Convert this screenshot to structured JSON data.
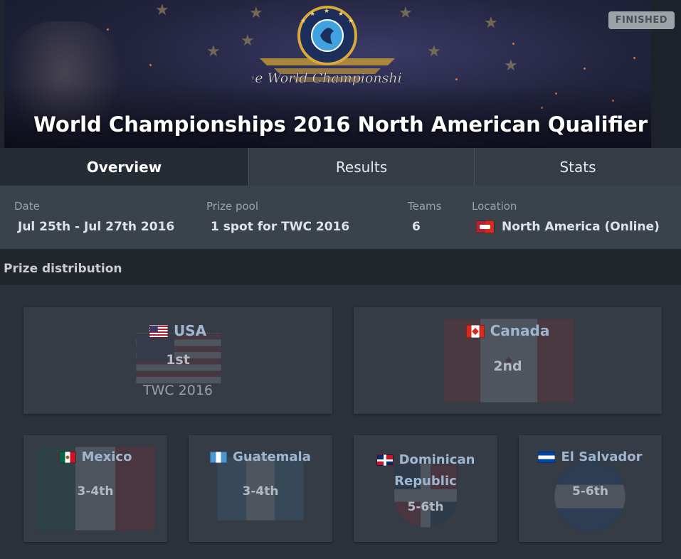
{
  "event": {
    "title": "World Championships 2016 North American Qualifier",
    "status": "FINISHED",
    "logo_text": "The World Championships"
  },
  "tabs": [
    {
      "label": "Overview",
      "active": true
    },
    {
      "label": "Results",
      "active": false
    },
    {
      "label": "Stats",
      "active": false
    }
  ],
  "info": {
    "date_label": "Date",
    "date_value": "Jul 25th - Jul 27th 2016",
    "prize_label": "Prize pool",
    "prize_value": "1 spot for TWC 2016",
    "teams_label": "Teams",
    "teams_value": "6",
    "location_label": "Location",
    "location_value": "North America (Online)",
    "location_flag_icon": "north-america-flag-icon"
  },
  "prize_distribution": {
    "title": "Prize distribution",
    "placements": [
      {
        "team": "USA",
        "place": "1st",
        "prize": "TWC 2016",
        "flag_icon": "usa-flag-icon"
      },
      {
        "team": "Canada",
        "place": "2nd",
        "prize": "",
        "flag_icon": "canada-flag-icon"
      },
      {
        "team": "Mexico",
        "place": "3-4th",
        "prize": "",
        "flag_icon": "mexico-flag-icon"
      },
      {
        "team": "Guatemala",
        "place": "3-4th",
        "prize": "",
        "flag_icon": "guatemala-flag-icon"
      },
      {
        "team_line1": "Dominican",
        "team_line2": "Republic",
        "place": "5-6th",
        "prize": "",
        "flag_icon": "dominican-republic-flag-icon"
      },
      {
        "team": "El Salvador",
        "place": "5-6th",
        "prize": "",
        "flag_icon": "el-salvador-flag-icon"
      }
    ]
  },
  "colors": {
    "team_name": "#9eb6cf",
    "background": "#2b323c",
    "card": "#353c46",
    "status_badge": "#9ea3a8"
  }
}
